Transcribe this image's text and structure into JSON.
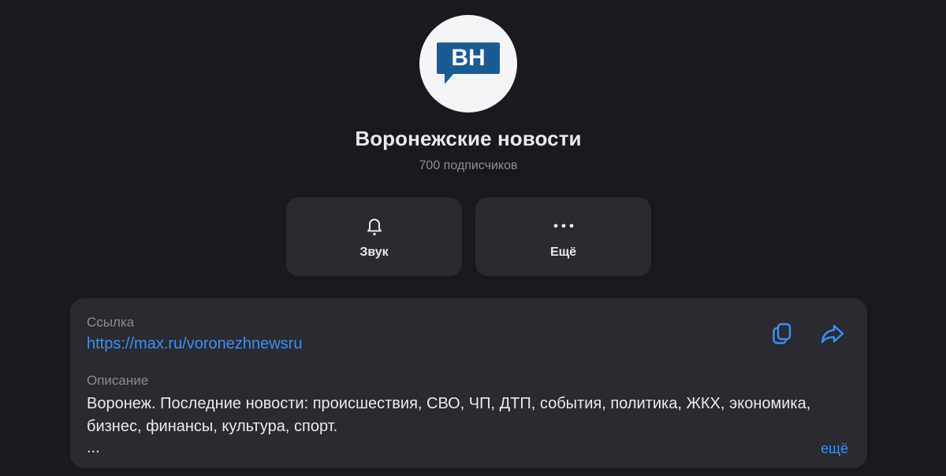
{
  "channel": {
    "logo_text": "ВН",
    "title": "Воронежские новости",
    "subscribers": "700 подписчиков"
  },
  "actions": [
    {
      "label": "Звук",
      "icon": "bell-icon"
    },
    {
      "label": "Ещё",
      "icon": "more-dots-icon"
    }
  ],
  "info": {
    "link_label": "Ссылка",
    "link_value": "https://max.ru/voronezhnewsru",
    "description_label": "Описание",
    "description_text": "Воронеж. Последние новости: происшествия, СВО, ЧП, ДТП, события, политика, ЖКХ, экономика, бизнес, финансы, культура, спорт.",
    "description_ellipsis": "...",
    "more_label": "ещё",
    "copy_icon": "copy-icon",
    "share_icon": "share-icon"
  },
  "colors": {
    "background": "#1a1a1e",
    "card": "#2a2a30",
    "accent": "#3d8ef2",
    "logo_blue": "#1a5b96"
  }
}
